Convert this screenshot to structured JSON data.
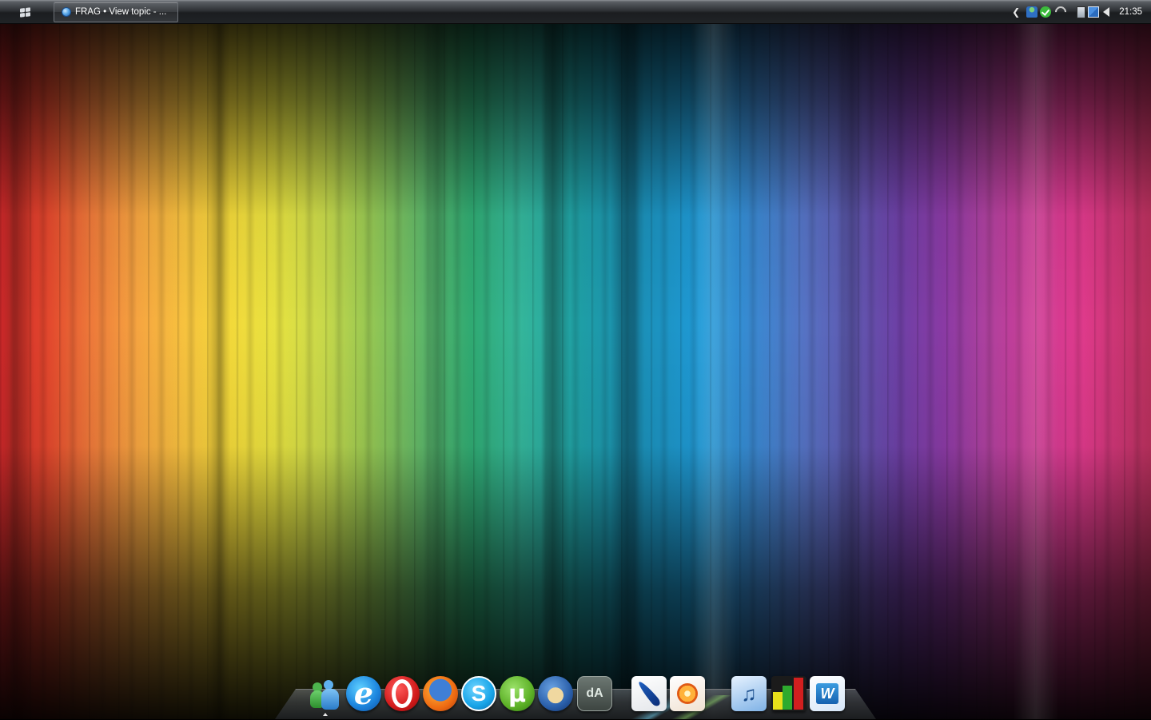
{
  "desktop": {
    "wallpaper": "spectrum-light-streaks"
  },
  "taskbar": {
    "start_icon": "windows-logo-icon",
    "windows": [
      {
        "title": "FRAG • View topic - ...",
        "icon": "globe-icon"
      }
    ],
    "tray": {
      "expand_icon": "chevron-left-icon",
      "icons": [
        "users-icon",
        "check-shield-icon",
        "wireless-icon",
        "power-icon",
        "network-icon",
        "volume-icon"
      ],
      "clock": "21:35"
    }
  },
  "dock": {
    "items": [
      {
        "name": "Windows Live Messenger",
        "icon": "messenger-icon",
        "running": true
      },
      {
        "name": "Internet Explorer",
        "icon": "internet-explorer-icon",
        "glyph": "e"
      },
      {
        "name": "Opera",
        "icon": "opera-icon"
      },
      {
        "name": "Firefox",
        "icon": "firefox-icon"
      },
      {
        "name": "Skype",
        "icon": "skype-icon",
        "glyph": "S"
      },
      {
        "name": "uTorrent",
        "icon": "utorrent-icon",
        "glyph": "µ"
      },
      {
        "name": "Thunderbird",
        "icon": "thunderbird-icon"
      },
      {
        "name": "deviantART",
        "icon": "deviantart-icon",
        "glyph": "dA"
      },
      {
        "name": "Feather",
        "icon": "feather-icon"
      },
      {
        "name": "Photo viewer",
        "icon": "flower-icon"
      },
      {
        "name": "iTunes",
        "icon": "itunes-icon",
        "glyph": "♫"
      },
      {
        "name": "Chart app",
        "icon": "bar-chart-icon"
      },
      {
        "name": "Word",
        "icon": "word-icon",
        "glyph": "W"
      }
    ]
  },
  "colors": {
    "taskbar": "#2f3236",
    "text": "#ffffff"
  }
}
